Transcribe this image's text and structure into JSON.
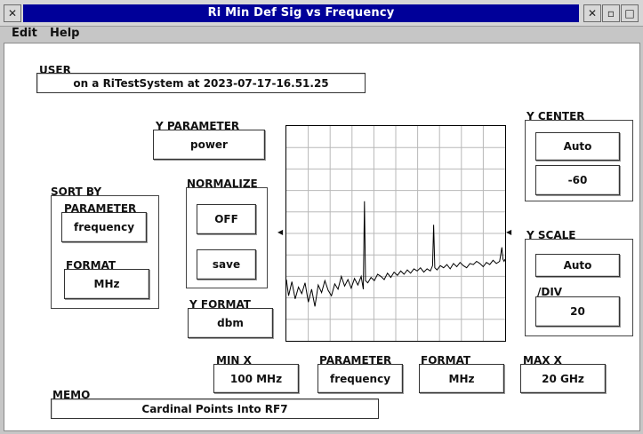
{
  "window": {
    "title": "Ri Min Def Sig vs Frequency",
    "controls": {
      "close_icon": "close-x-icon",
      "minimize_icon": "minimize-icon",
      "maximize_icon": "maximize-icon",
      "dismiss_icon": "close-x-icon"
    }
  },
  "menu": {
    "edit": "Edit",
    "help": "Help"
  },
  "user": {
    "label": "USER",
    "value": "on a RiTestSystem at 2023-07-17-16.51.25"
  },
  "y_parameter": {
    "label": "Y PARAMETER",
    "value": "power"
  },
  "normalize": {
    "label": "NORMALIZE",
    "toggle": "OFF",
    "save": "save"
  },
  "sort_by": {
    "label": "SORT BY",
    "parameter_label": "PARAMETER",
    "parameter_value": "frequency",
    "format_label": "FORMAT",
    "format_value": "MHz"
  },
  "y_format": {
    "label": "Y FORMAT",
    "value": "dbm"
  },
  "y_center": {
    "label": "Y CENTER",
    "mode": "Auto",
    "value": "-60"
  },
  "y_scale": {
    "label": "Y SCALE",
    "mode": "Auto",
    "div_label": "/DIV",
    "div_value": "20"
  },
  "x_axis": {
    "min_label": "MIN X",
    "min_value": "100 MHz",
    "parameter_label": "PARAMETER",
    "parameter_value": "frequency",
    "format_label": "FORMAT",
    "format_value": "MHz",
    "max_label": "MAX X",
    "max_value": "20 GHz"
  },
  "memo": {
    "label": "MEMO",
    "value": "Cardinal Points Into RF7"
  },
  "chart_data": {
    "type": "line",
    "title": "",
    "xlabel": "",
    "ylabel": "",
    "xlim": [
      100,
      20000
    ],
    "ylim": [
      -160,
      40
    ],
    "grid": true,
    "xdivisions": 10,
    "ydivisions": 10,
    "line_color": "#000000",
    "grid_color": "#b8b8b8",
    "series": [
      {
        "x": [
          100,
          300,
          600,
          900,
          1200,
          1500,
          1800,
          2100,
          2400,
          2700,
          3000,
          3300,
          3600,
          3900,
          4200,
          4500,
          4800,
          5100,
          5400,
          5700,
          6000,
          6300,
          6600,
          6900,
          7100,
          7200,
          7300,
          7500,
          7800,
          8100,
          8400,
          8700,
          9000,
          9300,
          9600,
          9900,
          10200,
          10500,
          10800,
          11100,
          11400,
          11700,
          12000,
          12300,
          12600,
          12900,
          13200,
          13400,
          13500,
          13600,
          13800,
          14100,
          14400,
          14700,
          15000,
          15300,
          15600,
          15900,
          16200,
          16500,
          16800,
          17100,
          17400,
          17700,
          18000,
          18300,
          18600,
          18900,
          19200,
          19500,
          19700,
          19800,
          19900,
          20000
        ],
        "y": [
          -103,
          -118,
          -105,
          -121,
          -110,
          -116,
          -106,
          -124,
          -112,
          -128,
          -108,
          -115,
          -104,
          -113,
          -118,
          -107,
          -112,
          -100,
          -109,
          -103,
          -111,
          -102,
          -108,
          -100,
          -112,
          -30,
          -104,
          -106,
          -101,
          -104,
          -98,
          -100,
          -103,
          -97,
          -101,
          -96,
          -99,
          -95,
          -98,
          -94,
          -97,
          -93,
          -95,
          -92,
          -96,
          -93,
          -95,
          -90,
          -52,
          -92,
          -94,
          -90,
          -92,
          -89,
          -93,
          -88,
          -91,
          -87,
          -90,
          -92,
          -88,
          -89,
          -86,
          -88,
          -91,
          -87,
          -89,
          -85,
          -88,
          -86,
          -73,
          -84,
          -86,
          -84
        ]
      }
    ]
  }
}
